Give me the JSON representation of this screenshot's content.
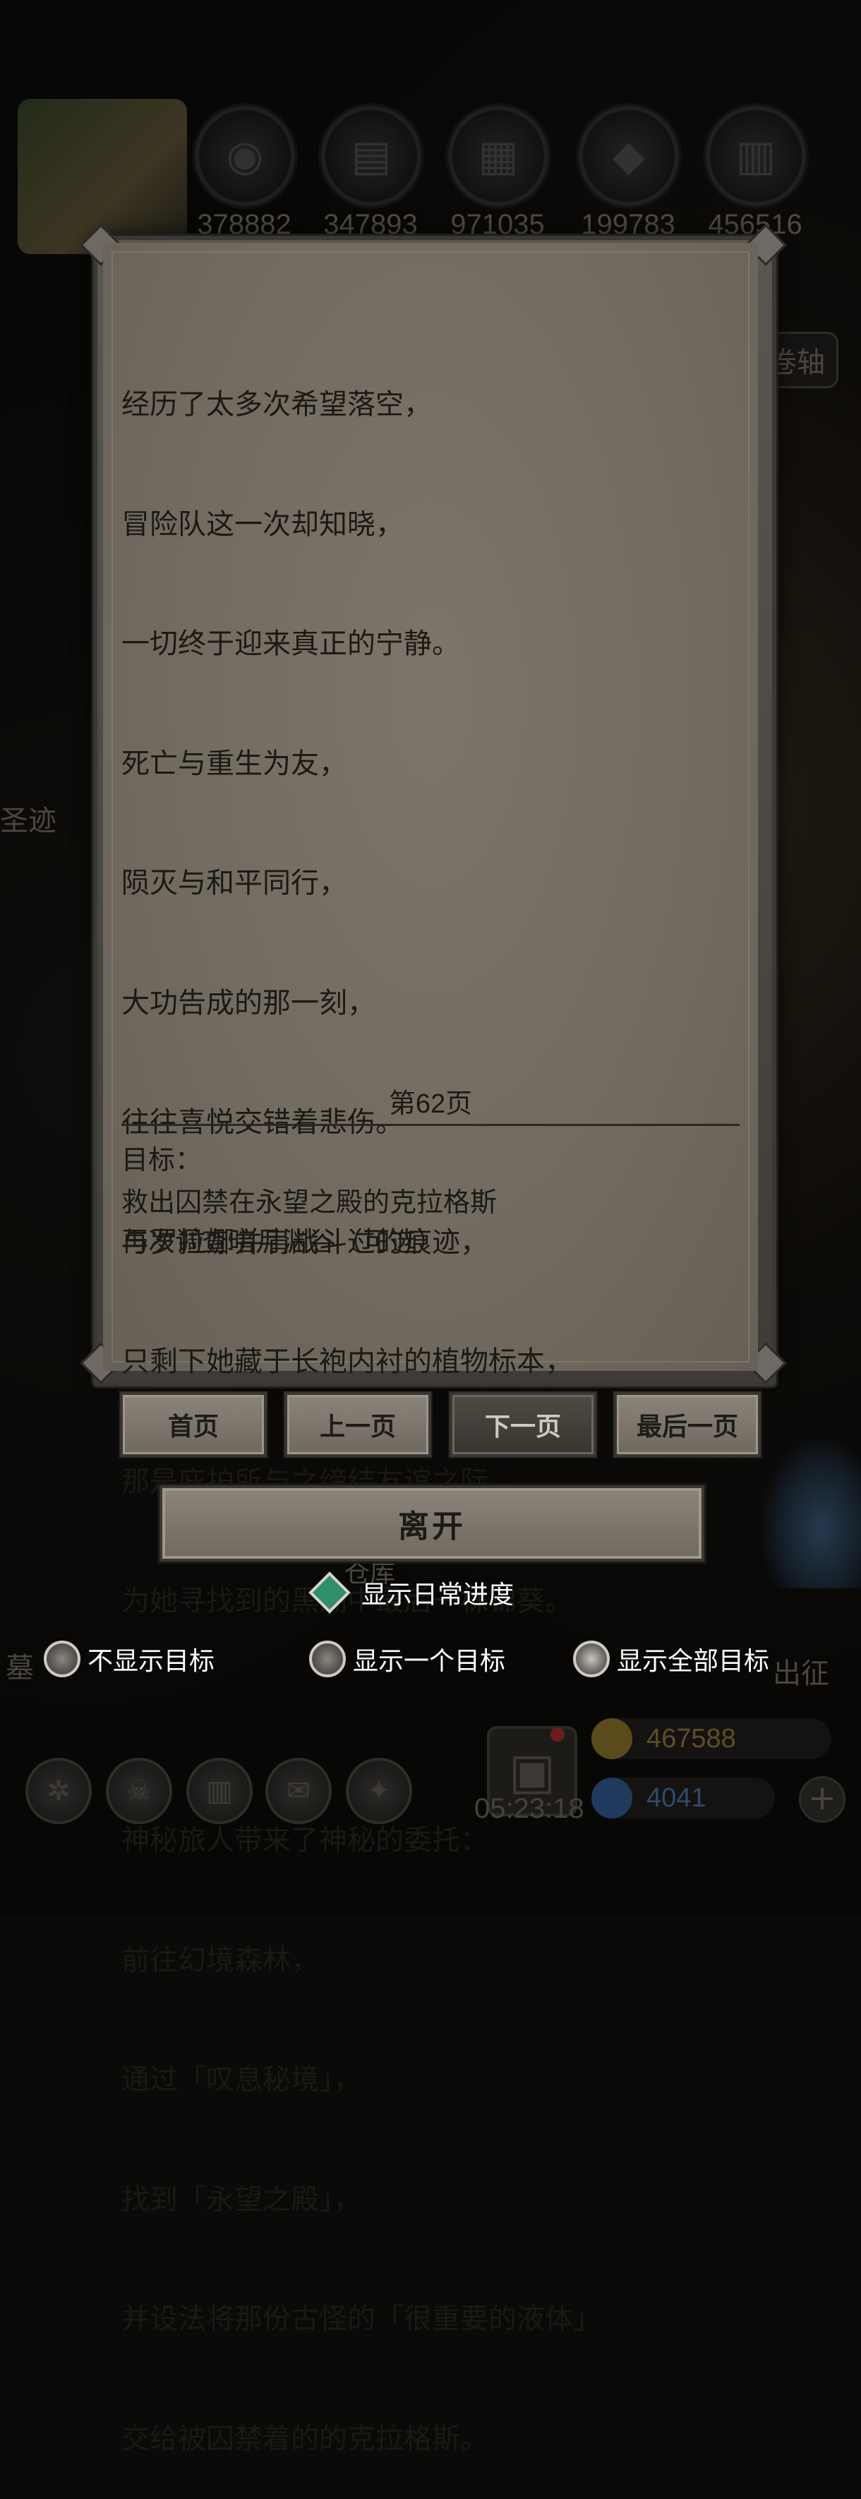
{
  "resources": [
    {
      "icon": "meat-icon",
      "value": "378882"
    },
    {
      "icon": "wood-icon",
      "value": "347893"
    },
    {
      "icon": "iron-icon",
      "value": "971035"
    },
    {
      "icon": "crystal-icon",
      "value": "199783"
    },
    {
      "icon": "ingot-icon",
      "value": "456516"
    }
  ],
  "background": {
    "scroll_chip": "卷轴",
    "side_label": "圣迹",
    "warehouse_label": "仓库",
    "grave_label": "墓",
    "expedition_label": "出征",
    "timer": "05:23:18",
    "gold": "467588",
    "gems": "4041"
  },
  "story": {
    "lines": [
      "经历了太多次希望落空，",
      "冒险队这一次却知晓，",
      "一切终于迎来真正的宁静。",
      "死亡与重生为友，",
      "陨灭与和平同行，",
      "大功告成的那一刻，",
      "往往喜悦交错着悲伤。",
      "与罗拉娜并肩战斗过的痕迹，",
      "只剩下她藏于长袍内衬的植物标本，",
      "那是庇护所与之缔结友谊之际，",
      "为她寻找到的黑潮中最后一株锦葵。",
      "",
      "神秘旅人带来了神秘的委托：",
      "前往幻境森林，",
      "通过「叹息秘境」，",
      "找到「永望之殿」，",
      "并设法将那份古怪的「很重要的液体」",
      "交给被囚禁着的的克拉格斯。"
    ],
    "page_label": "第62页"
  },
  "goals": {
    "heading": "目标：",
    "items": [
      "救出囚禁在永望之殿的克拉格斯",
      "再次调查暗月渊谷（可选）"
    ]
  },
  "nav": {
    "first": "首页",
    "prev": "上一页",
    "next": "下一页",
    "last": "最后一页",
    "leave": "离开"
  },
  "options": {
    "show_daily": "显示日常进度",
    "hide_goals": "不显示目标",
    "show_one": "显示一个目标",
    "show_all": "显示全部目标",
    "selected": "show_all"
  },
  "colors": {
    "parchment": "#766e63",
    "text": "#1b1915",
    "toggle_green": "#2f8f6a"
  }
}
